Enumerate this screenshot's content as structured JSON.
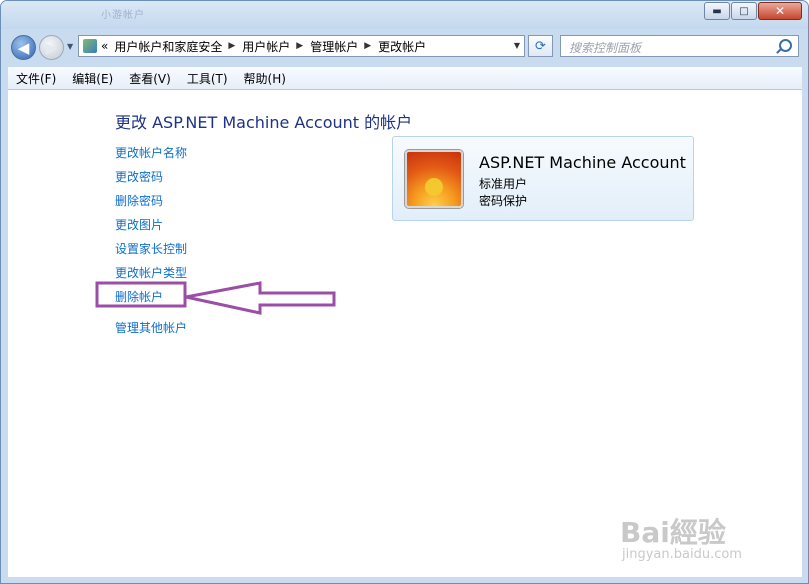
{
  "window": {
    "title_ghost": "小游帐户"
  },
  "nav": {
    "breadcrumb": [
      "«",
      "用户帐户和家庭安全",
      "用户帐户",
      "管理帐户",
      "更改帐户"
    ],
    "search_placeholder": "搜索控制面板"
  },
  "menu": [
    "文件(F)",
    "编辑(E)",
    "查看(V)",
    "工具(T)",
    "帮助(H)"
  ],
  "page": {
    "heading": "更改 ASP.NET Machine Account 的帐户",
    "tasks": [
      "更改帐户名称",
      "更改密码",
      "删除密码",
      "更改图片",
      "设置家长控制",
      "更改帐户类型",
      "删除帐户",
      "管理其他帐户"
    ],
    "highlighted_task": "删除帐户"
  },
  "account": {
    "name": "ASP.NET Machine Account",
    "type": "标准用户",
    "status": "密码保护"
  },
  "annotation_color": "#9b4ea6",
  "watermark": {
    "brand": "Bai經验",
    "sub": "jingyan.baidu.com"
  }
}
